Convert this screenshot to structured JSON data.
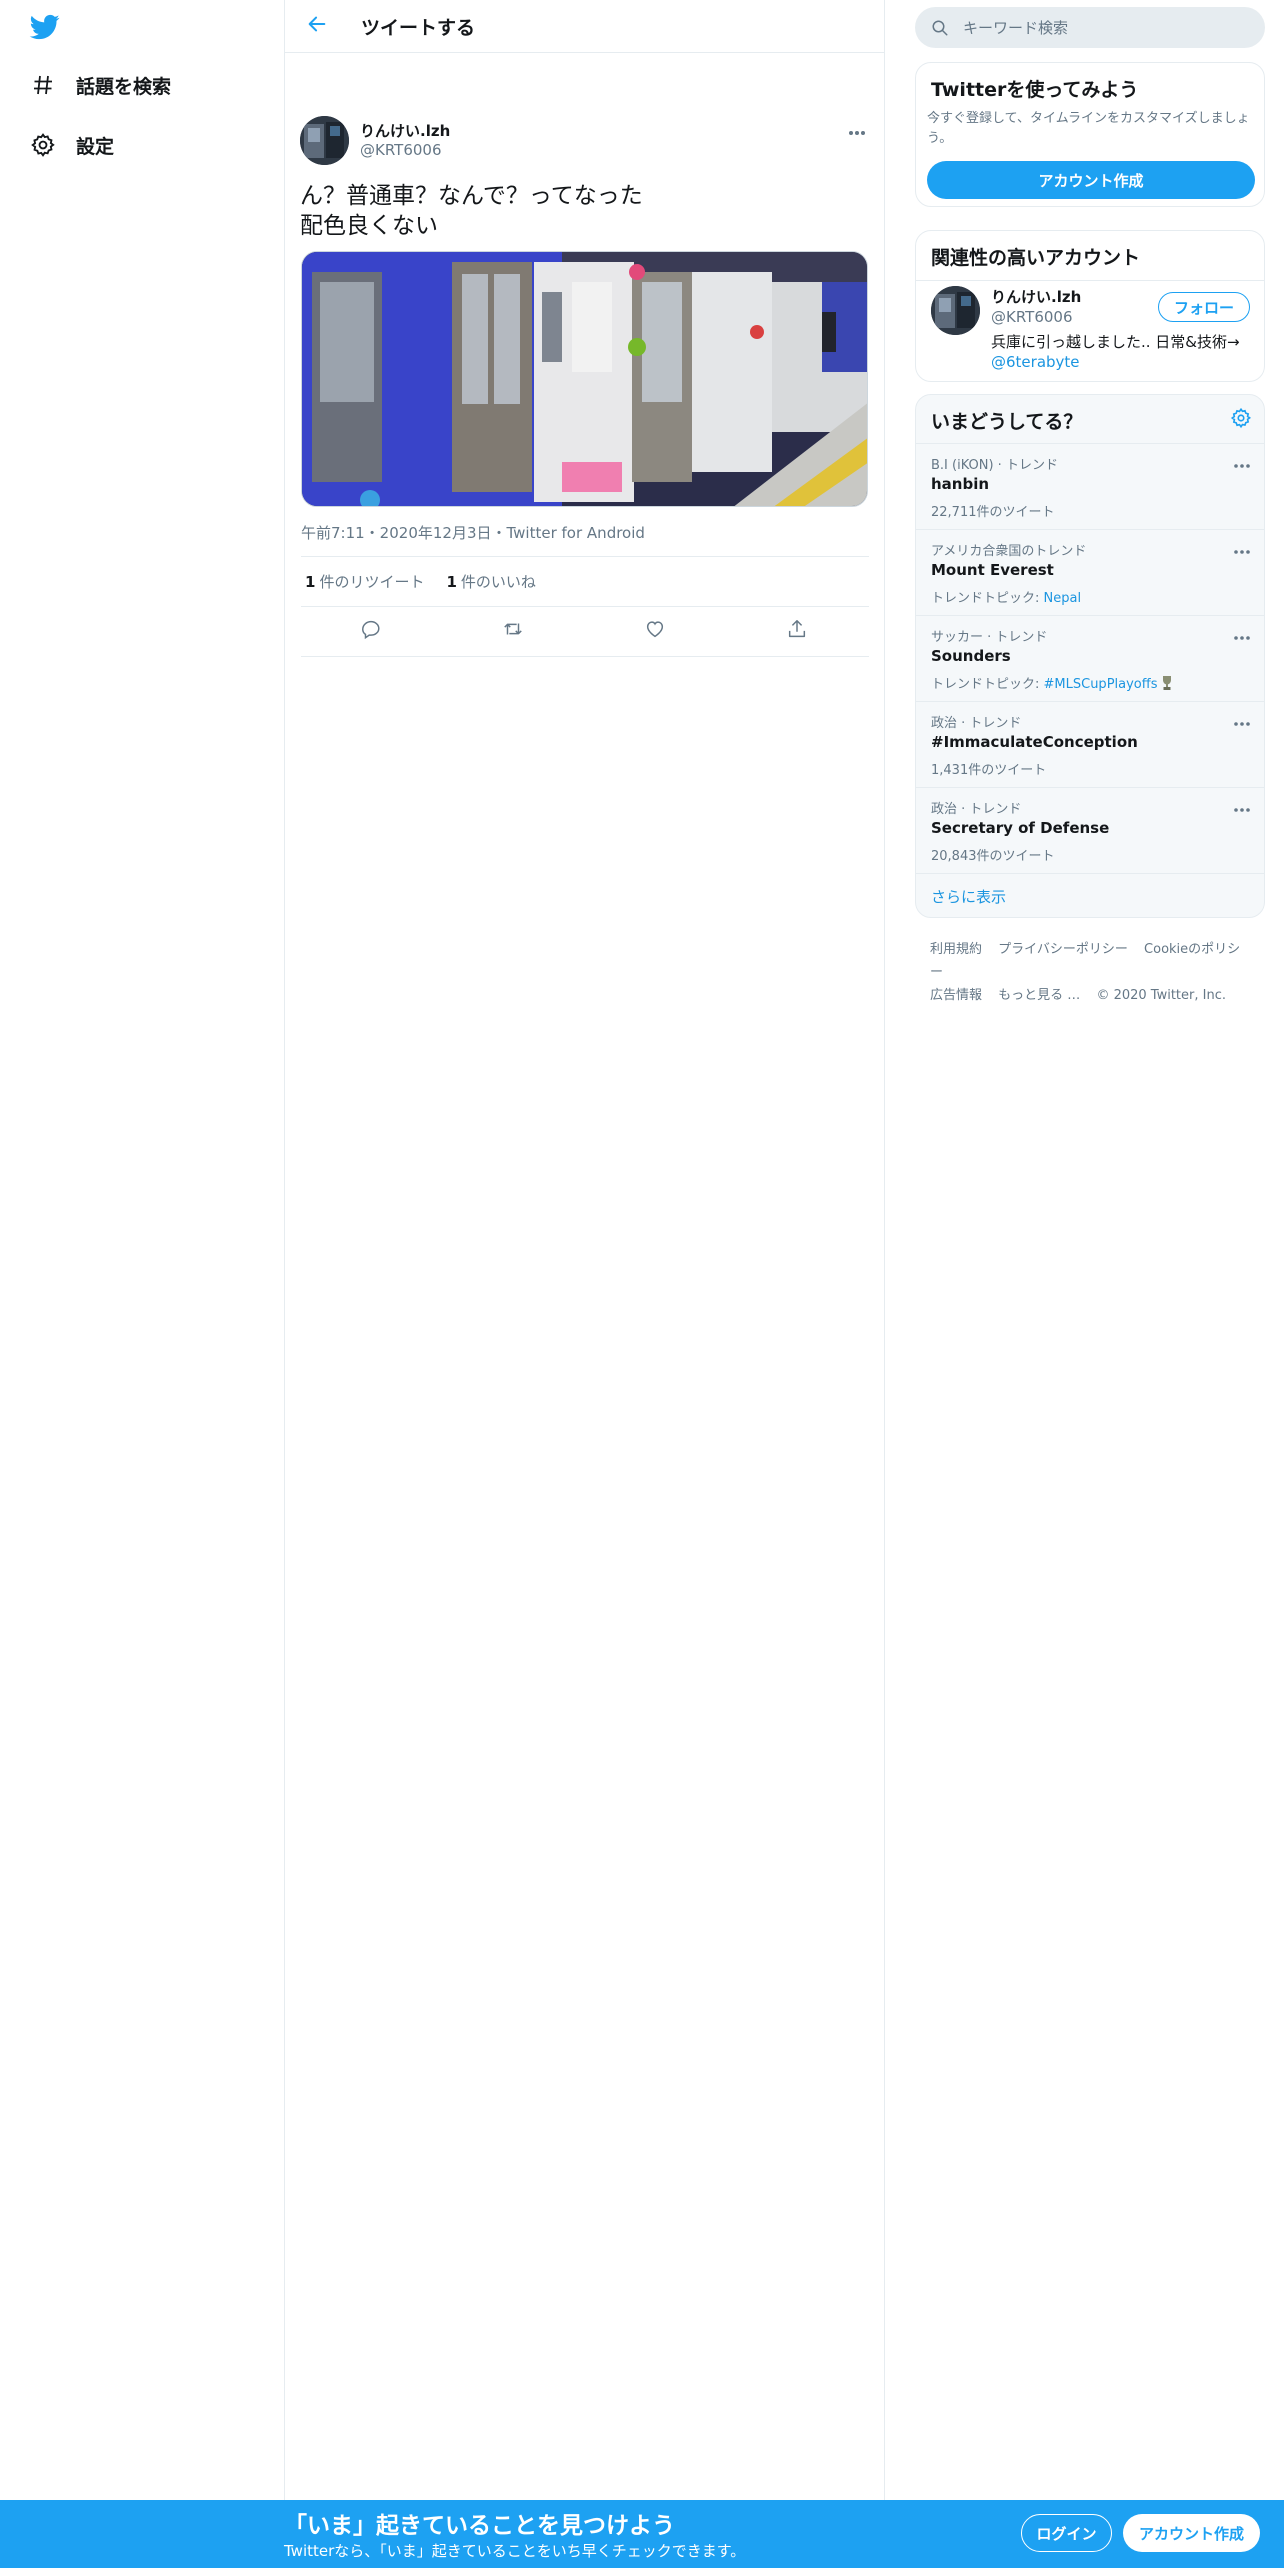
{
  "colors": {
    "brand": "#1da1f2",
    "link": "#1b95e0",
    "text_primary": "#14171a",
    "text_secondary": "#657786",
    "border": "#e6ecf0",
    "panel": "#f5f8fa"
  },
  "sidebar": {
    "logo_icon": "twitter-bird-icon",
    "items": [
      {
        "label": "話題を検索",
        "icon": "hashtag-icon"
      },
      {
        "label": "設定",
        "icon": "gear-icon"
      }
    ]
  },
  "header": {
    "back_icon": "arrow-left-icon",
    "title": "ツイートする"
  },
  "tweet": {
    "author_name": "りんけい.lzh",
    "author_handle": "@KRT6006",
    "text": "ん？普通車？なんで？ってなった\n配色良くない",
    "media_alt": "",
    "timestamp": "午前7:11・2020年12月3日・Twitter for Android",
    "retweet_count": "1",
    "retweet_label": "件のリツイート",
    "like_count": "1",
    "like_label": "件のいいね",
    "actions": [
      "reply-icon",
      "retweet-icon",
      "like-icon",
      "share-icon"
    ]
  },
  "search": {
    "placeholder": "キーワード検索"
  },
  "signup_card": {
    "title": "Twitterを使ってみよう",
    "description": "今すぐ登録して、タイムラインをカスタマイズしましょう。",
    "button": "アカウント作成"
  },
  "related": {
    "title": "関連性の高いアカウント",
    "name": "りんけい.lzh",
    "handle": "@KRT6006",
    "follow": "フォロー",
    "bio": "兵庫に引っ越しました.. 日常&技術→",
    "bio_mention": "@6terabyte"
  },
  "trends": {
    "title": "いまどうしてる？",
    "items": [
      {
        "context": "B.I (iKON) · トレンド",
        "name": "hanbin",
        "sub": "22,711件のツイート",
        "sub_link": ""
      },
      {
        "context": "アメリカ合衆国のトレンド",
        "name": "Mount Everest",
        "sub": "トレンドトピック: ",
        "sub_link": "Nepal"
      },
      {
        "context": "サッカー · トレンド",
        "name": "Sounders",
        "sub": "トレンドトピック: ",
        "sub_link": "#MLSCupPlayoffs"
      },
      {
        "context": "政治 · トレンド",
        "name": "#ImmaculateConception",
        "sub": "1,431件のツイート",
        "sub_link": ""
      },
      {
        "context": "政治 · トレンド",
        "name": "Secretary of Defense",
        "sub": "20,843件のツイート",
        "sub_link": ""
      }
    ],
    "show_more": "さらに表示"
  },
  "footer": {
    "links": [
      "利用規約",
      "プライバシーポリシー",
      "Cookieのポリシー",
      "広告情報",
      "もっと見る …"
    ],
    "copyright": "© 2020 Twitter, Inc."
  },
  "bottom_bar": {
    "title": "「いま」起きていることを見つけよう",
    "subtitle": "Twitterなら、「いま」起きていることをいち早くチェックできます。",
    "login": "ログイン",
    "signup": "アカウント作成"
  }
}
